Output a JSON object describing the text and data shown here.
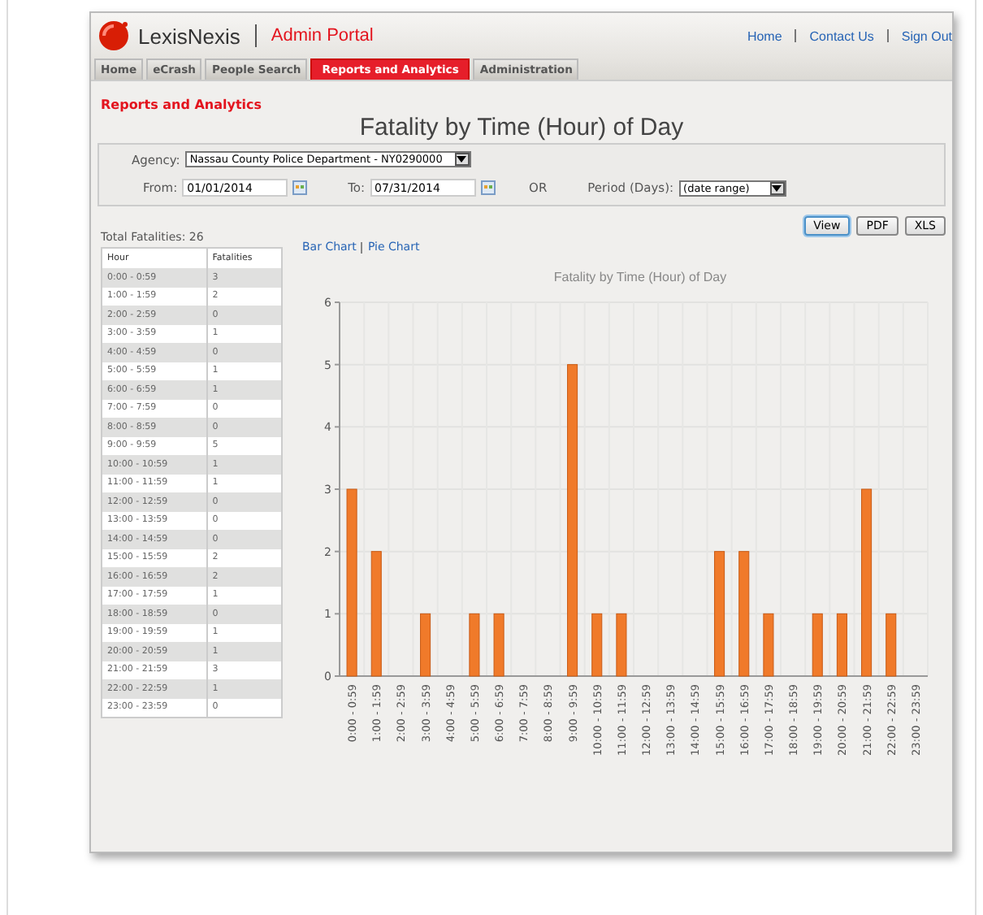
{
  "header": {
    "brand": "LexisNexis",
    "portal": "Admin Portal",
    "links": [
      "Home",
      "Contact Us",
      "Sign Out"
    ]
  },
  "tabs": [
    {
      "label": "Home",
      "selected": false
    },
    {
      "label": "eCrash",
      "selected": false
    },
    {
      "label": "People Search",
      "selected": false
    },
    {
      "label": "Reports and Analytics",
      "selected": true
    },
    {
      "label": "Administration",
      "selected": false
    }
  ],
  "section_title": "Reports and Analytics",
  "report_title": "Fatality by Time (Hour) of Day",
  "filters": {
    "agency_label": "Agency:",
    "agency": "Nassau County Police Department - NY0290000",
    "from_label": "From:",
    "from": "01/01/2014",
    "to_label": "To:",
    "to": "07/31/2014",
    "or": "OR",
    "period_label": "Period (Days):",
    "period": "(date range)"
  },
  "buttons": [
    {
      "label": "View",
      "selected": true
    },
    {
      "label": "PDF",
      "selected": false
    },
    {
      "label": "XLS",
      "selected": false
    }
  ],
  "total": "Total Fatalities: 26",
  "table": {
    "columns": [
      "Hour",
      "Fatalities"
    ],
    "rows": [
      [
        "0:00 - 0:59",
        "3"
      ],
      [
        "1:00 - 1:59",
        "2"
      ],
      [
        "2:00 - 2:59",
        "0"
      ],
      [
        "3:00 - 3:59",
        "1"
      ],
      [
        "4:00 - 4:59",
        "0"
      ],
      [
        "5:00 - 5:59",
        "1"
      ],
      [
        "6:00 - 6:59",
        "1"
      ],
      [
        "7:00 - 7:59",
        "0"
      ],
      [
        "8:00 - 8:59",
        "0"
      ],
      [
        "9:00 - 9:59",
        "5"
      ],
      [
        "10:00 - 10:59",
        "1"
      ],
      [
        "11:00 - 11:59",
        "1"
      ],
      [
        "12:00 - 12:59",
        "0"
      ],
      [
        "13:00 - 13:59",
        "0"
      ],
      [
        "14:00 - 14:59",
        "0"
      ],
      [
        "15:00 - 15:59",
        "2"
      ],
      [
        "16:00 - 16:59",
        "2"
      ],
      [
        "17:00 - 17:59",
        "1"
      ],
      [
        "18:00 - 18:59",
        "0"
      ],
      [
        "19:00 - 19:59",
        "1"
      ],
      [
        "20:00 - 20:59",
        "1"
      ],
      [
        "21:00 - 21:59",
        "3"
      ],
      [
        "22:00 - 22:59",
        "1"
      ],
      [
        "23:00 - 23:59",
        "0"
      ]
    ]
  },
  "chart_links": [
    "Bar Chart",
    "Pie Chart"
  ],
  "chart": {
    "chart_data": {
      "type": "bar",
      "title": "Fatality by Time (Hour) of Day",
      "categories": [
        "0:00 - 0:59",
        "1:00 - 1:59",
        "2:00 - 2:59",
        "3:00 - 3:59",
        "4:00 - 4:59",
        "5:00 - 5:59",
        "6:00 - 6:59",
        "7:00 - 7:59",
        "8:00 - 8:59",
        "9:00 - 9:59",
        "10:00 - 10:59",
        "11:00 - 11:59",
        "12:00 - 12:59",
        "13:00 - 13:59",
        "14:00 - 14:59",
        "15:00 - 15:59",
        "16:00 - 16:59",
        "17:00 - 17:59",
        "18:00 - 18:59",
        "19:00 - 19:59",
        "20:00 - 20:59",
        "21:00 - 21:59",
        "22:00 - 22:59",
        "23:00 - 23:59"
      ],
      "series": [
        {
          "color": "#f07a2a",
          "values": [
            3,
            2,
            0,
            1,
            0,
            1,
            1,
            0,
            0,
            5,
            1,
            1,
            0,
            0,
            0,
            2,
            2,
            1,
            0,
            1,
            1,
            3,
            1,
            0
          ]
        }
      ],
      "grid": true,
      "ylim": [
        0,
        6
      ],
      "yticks": [
        0,
        1,
        2,
        3,
        4,
        5,
        6
      ]
    }
  }
}
